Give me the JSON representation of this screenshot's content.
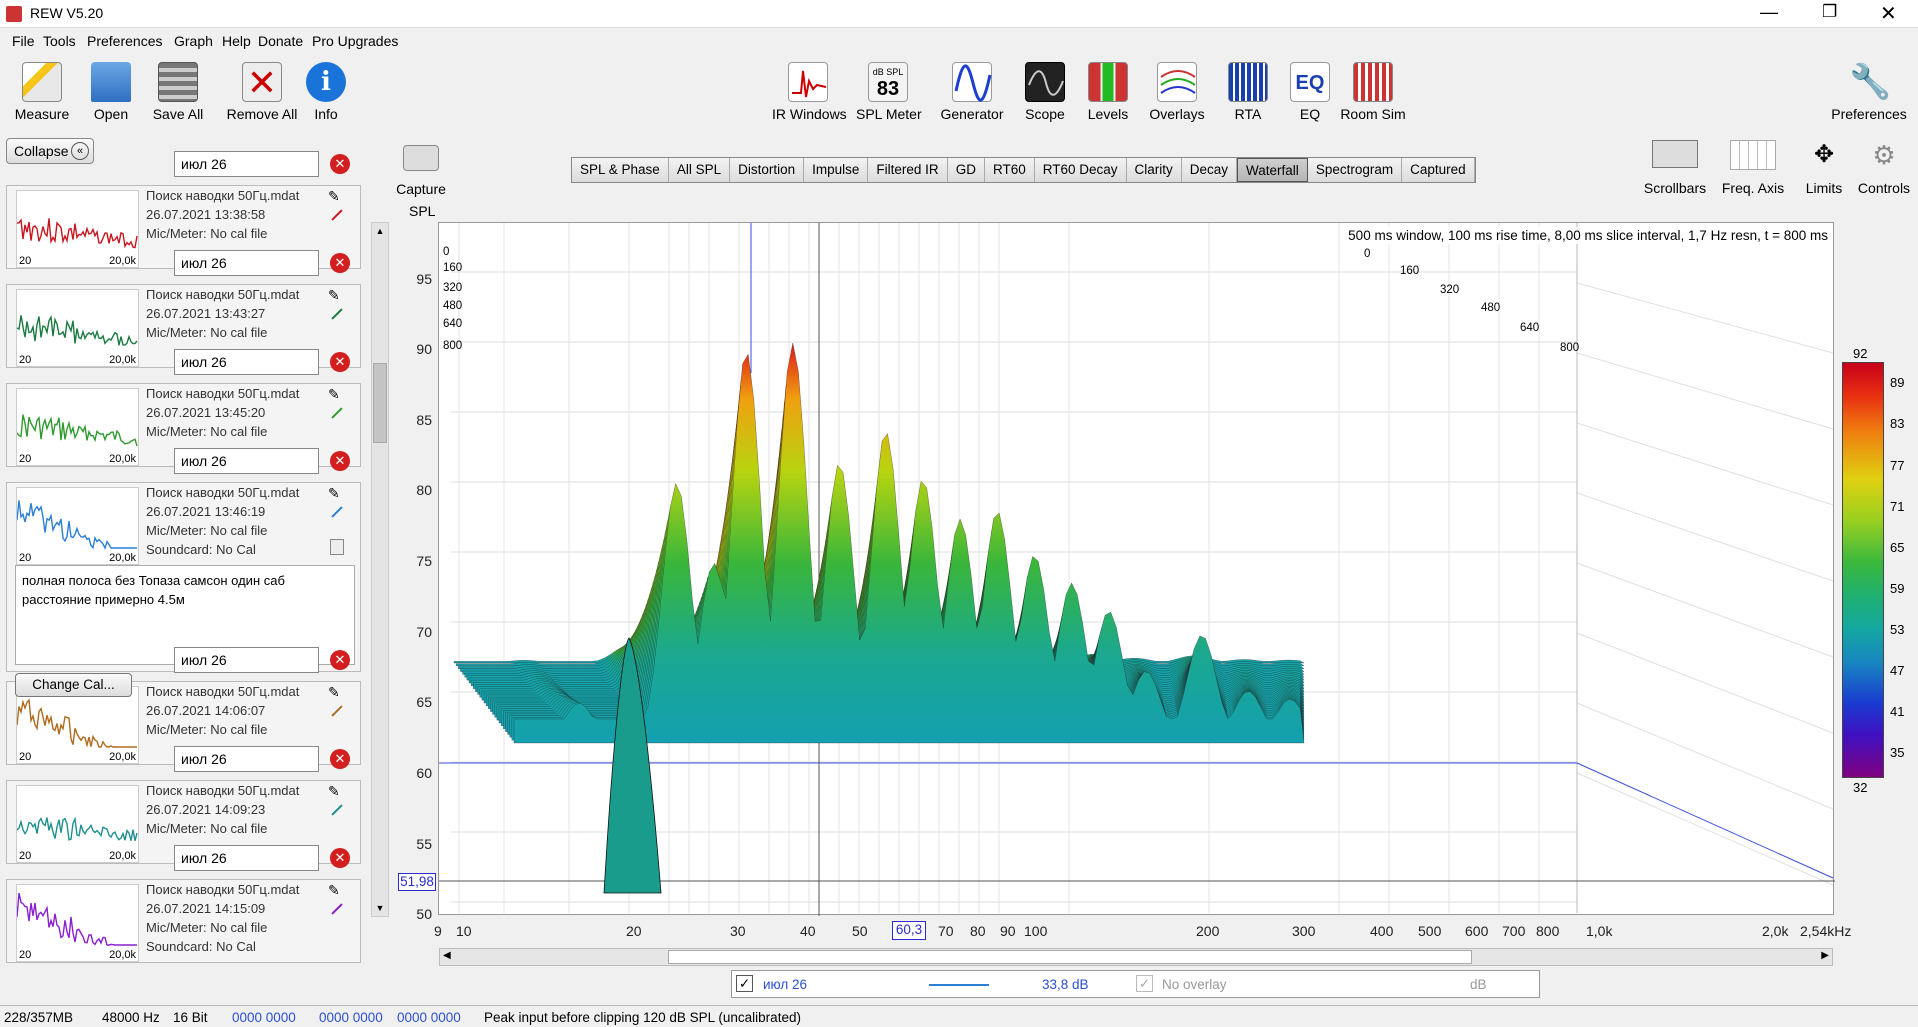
{
  "app": {
    "title": "REW V5.20"
  },
  "menu": [
    "File",
    "Tools",
    "Preferences",
    "Graph",
    "Help",
    "Donate",
    "Pro Upgrades"
  ],
  "toolbar_left": [
    {
      "label": "Measure",
      "icon": "measure-icon"
    },
    {
      "label": "Open",
      "icon": "folder-icon"
    },
    {
      "label": "Save All",
      "icon": "save-icon"
    },
    {
      "label": "Remove All",
      "icon": "remove-all-icon"
    },
    {
      "label": "Info",
      "icon": "info-icon"
    }
  ],
  "toolbar_mid": [
    {
      "label": "IR Windows",
      "icon": "ir-windows-icon"
    },
    {
      "label": "SPL Meter",
      "icon": "spl-meter-icon",
      "top": "dB SPL",
      "value": "83"
    },
    {
      "label": "Generator",
      "icon": "generator-icon"
    },
    {
      "label": "Scope",
      "icon": "scope-icon"
    },
    {
      "label": "Levels",
      "icon": "levels-icon"
    },
    {
      "label": "Overlays",
      "icon": "overlays-icon"
    },
    {
      "label": "RTA",
      "icon": "rta-icon"
    },
    {
      "label": "EQ",
      "icon": "eq-icon"
    },
    {
      "label": "Room Sim",
      "icon": "room-sim-icon"
    }
  ],
  "preferences": "Preferences",
  "collapse": "Collapse",
  "capture": "Capture",
  "graph_tabs": [
    "SPL & Phase",
    "All SPL",
    "Distortion",
    "Impulse",
    "Filtered IR",
    "GD",
    "RT60",
    "RT60 Decay",
    "Clarity",
    "Decay",
    "Waterfall",
    "Spectrogram",
    "Captured"
  ],
  "selected_tab": "Waterfall",
  "graph_tools": [
    "Scrollbars",
    "Freq. Axis",
    "Limits",
    "Controls"
  ],
  "measurements": [
    {
      "n": "1",
      "name": "июл 26",
      "file": "Поиск наводки 50Гц.mdat",
      "date": "26.07.2021 13:38:58",
      "mic": "Mic/Meter: No cal file",
      "color": "#c8161e"
    },
    {
      "n": "2",
      "name": "июл 26",
      "file": "Поиск наводки 50Гц.mdat",
      "date": "26.07.2021 13:43:27",
      "mic": "Mic/Meter: No cal file",
      "color": "#1a7a40"
    },
    {
      "n": "3",
      "name": "июл 26",
      "file": "Поиск наводки 50Гц.mdat",
      "date": "26.07.2021 13:45:20",
      "mic": "Mic/Meter: No cal file",
      "color": "#2f9a2f"
    },
    {
      "n": "4",
      "name": "июл 26",
      "file": "Поиск наводки 50Гц.mdat",
      "date": "26.07.2021 13:46:19",
      "mic": "Mic/Meter: No cal file",
      "sound": "Soundcard: No Cal",
      "color": "#2b7fd4"
    },
    {
      "n": "5",
      "name": "июл 26",
      "file": "Поиск наводки 50Гц.mdat",
      "date": "26.07.2021 14:06:07",
      "mic": "Mic/Meter: No cal file",
      "color": "#b06a20"
    },
    {
      "n": "6",
      "name": "июл 26",
      "file": "Поиск наводки 50Гц.mdat",
      "date": "26.07.2021 14:09:23",
      "mic": "Mic/Meter: No cal file",
      "color": "#1f8f8f"
    },
    {
      "n": "7",
      "name": "июл 26",
      "file": "Поиск наводки 50Гц.mdat",
      "date": "26.07.2021 14:15:09",
      "mic": "Mic/Meter: No cal file",
      "sound": "Soundcard: No Cal",
      "color": "#8a1fd0"
    }
  ],
  "thumb_x": [
    "20",
    "20,0k"
  ],
  "notes": "полная полоса без Топаза самсон один саб расстояние примерно 4.5м",
  "change_cal": "Change Cal...",
  "graph": {
    "ylabel": "SPL",
    "info": "500 ms window, 100 ms rise time, 8,00 ms slice interval, 1,7 Hz resn, t = 800 ms",
    "yticks": [
      "95",
      "90",
      "85",
      "80",
      "75",
      "70",
      "65",
      "60",
      "55",
      "50"
    ],
    "xticks": [
      "9",
      "10",
      "20",
      "30",
      "40",
      "50",
      "60,3",
      "70",
      "80",
      "90",
      "100",
      "200",
      "300",
      "400",
      "500",
      "600",
      "700",
      "800",
      "1,0k",
      "2,0k",
      "2,54kHz"
    ],
    "time_left": [
      "0",
      "160",
      "320",
      "480",
      "640",
      "800"
    ],
    "time_right": [
      "0",
      "160",
      "320",
      "480",
      "640",
      "800"
    ],
    "cursor_y": "51,98",
    "cursor_x": "60,3",
    "colorbar": [
      "92",
      "89",
      "83",
      "77",
      "71",
      "65",
      "59",
      "53",
      "47",
      "41",
      "35",
      "32"
    ]
  },
  "legend": {
    "name": "июл 26",
    "value": "33,8 dB",
    "overlay": "No overlay",
    "unit": "dB"
  },
  "status": {
    "mem": "228/357MB",
    "rate": "48000 Hz",
    "bits": "16 Bit",
    "hex": [
      "0000 0000",
      "0000 0000",
      "0000 0000"
    ],
    "msg": "Peak input before clipping 120 dB SPL (uncalibrated)"
  }
}
